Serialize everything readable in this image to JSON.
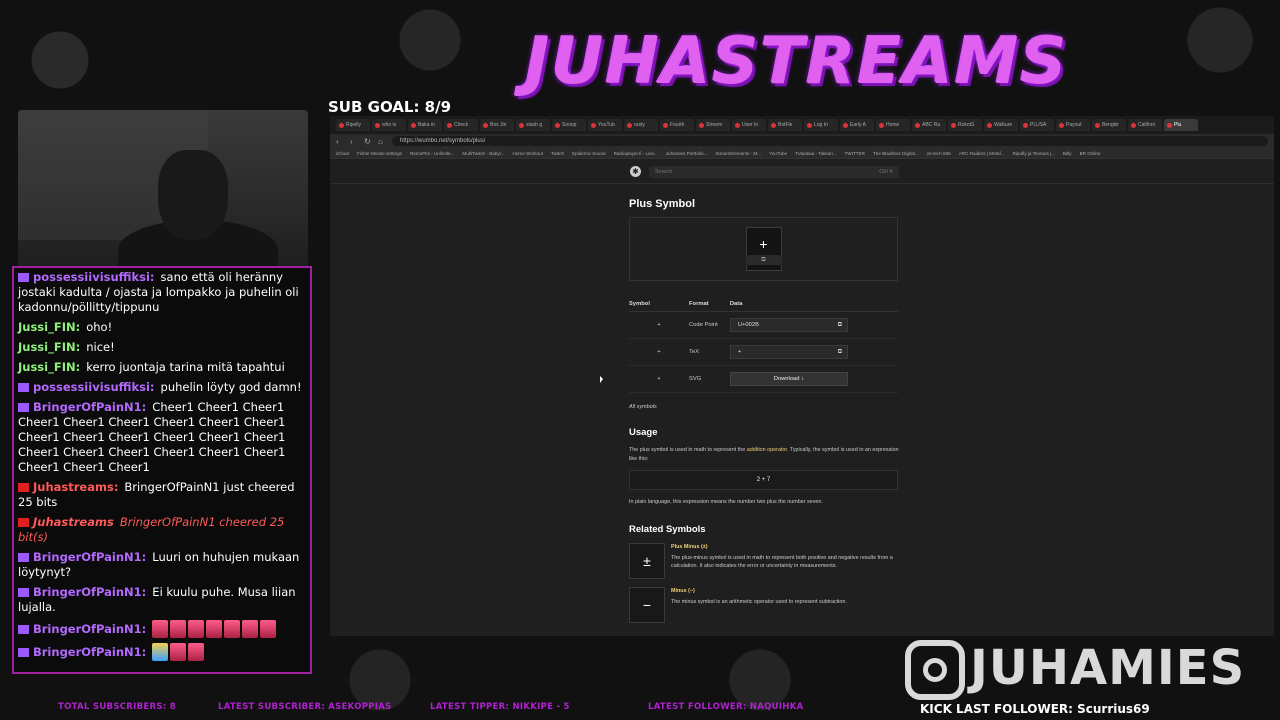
{
  "overlay": {
    "banner": "JUHASTREAMS",
    "sub_goal": "SUB GOAL: 8/9",
    "instagram": "JUHAMIES",
    "kick_follower": "KICK LAST FOLLOWER: Scurrius69",
    "tickers": [
      "TOTAL SUBSCRIBERS: 8",
      "LATEST SUBSCRIBER: ASEKOPPIAS",
      "LATEST TIPPER: NIKKIPE - 5",
      "LATEST FOLLOWER: NAQUIHKA"
    ]
  },
  "chat": {
    "messages": [
      {
        "user": "possessiivisuffiksi:",
        "text": "sano että oli heränny jostaki kadulta / ojasta ja lompakko ja puhelin oli kadonnu/pöllitty/tippunu",
        "color": "#b469ff",
        "badge": "sub"
      },
      {
        "user": "Jussi_FIN:",
        "text": "oho!",
        "color": "#8ef07a",
        "badge": ""
      },
      {
        "user": "Jussi_FIN:",
        "text": "nice!",
        "color": "#8ef07a",
        "badge": ""
      },
      {
        "user": "Jussi_FIN:",
        "text": "kerro juontaja tarina mitä tapahtui",
        "color": "#8ef07a",
        "badge": ""
      },
      {
        "user": "possessiivisuffiksi:",
        "text": "puhelin löyty god damn!",
        "color": "#b469ff",
        "badge": "sub"
      },
      {
        "user": "BringerOfPainN1:",
        "text": "Cheer1 Cheer1 Cheer1 Cheer1 Cheer1 Cheer1 Cheer1 Cheer1 Cheer1 Cheer1 Cheer1 Cheer1 Cheer1 Cheer1 Cheer1 Cheer1 Cheer1 Cheer1 Cheer1 Cheer1 Cheer1 Cheer1 Cheer1 Cheer1",
        "color": "#b469ff",
        "badge": "sub"
      },
      {
        "user": "Juhastreams:",
        "text": "BringerOfPainN1 just cheered 25 bits",
        "color": "#ff5a5a",
        "badge": "cam"
      },
      {
        "user": "Juhastreams",
        "text": "BringerOfPainN1 cheered 25 bit(s)",
        "color": "#ff5a5a",
        "badge": "cam",
        "italic": true
      },
      {
        "user": "BringerOfPainN1:",
        "text": "Luuri on huhujen mukaan löytynyt?",
        "color": "#b469ff",
        "badge": "sub"
      },
      {
        "user": "BringerOfPainN1:",
        "text": "Ei kuulu puhe. Musa liian lujalla.",
        "color": "#b469ff",
        "badge": "sub"
      },
      {
        "user": "BringerOfPainN1:",
        "text": "",
        "color": "#b469ff",
        "badge": "sub",
        "emotes": 7
      },
      {
        "user": "BringerOfPainN1:",
        "text": "",
        "color": "#b469ff",
        "badge": "sub",
        "emotes": 3
      }
    ]
  },
  "browser": {
    "tabs": [
      "Ripelly",
      "who is",
      "Baka m",
      "Check",
      "Box Jin",
      "stash g",
      "Sooop",
      "YouTub",
      "rusty",
      "Fourth",
      "Streem",
      "User In",
      "BotFle",
      "Log In",
      "Early A",
      "Home",
      "ABC Ra",
      "RokotS",
      "Walkure",
      "PLUSA",
      "Payout",
      "Bengkir",
      "Californ",
      "Plu"
    ],
    "url": "https://wumbo.net/symbols/plus/",
    "bookmarks": [
      "iCloud",
      "Fisher Mouse settings",
      "RemoPiIs - Unlimite...",
      "MultiTwitch - Babyl...",
      "Home Workout",
      "Twitch",
      "Epidemic Sound",
      "Radioplayer.fi - Live...",
      "Juhamies Portfolio...",
      "StreamElements - M...",
      "YouTube",
      "TVaiataia - Takkari...",
      "TWITTER",
      "The Blackbox Digital...",
      "ze-tech 865",
      "ARC Raiders | Metaf...",
      "Ripulfy ja Tentaus j...",
      "Bitly",
      "BR Online"
    ],
    "search_placeholder": "Search",
    "search_shortcut": "Ctrl K"
  },
  "page": {
    "title": "Plus Symbol",
    "glyph": "+",
    "copy_icon": "⧉",
    "table_headers": [
      "Symbol",
      "Format",
      "Data"
    ],
    "rows": [
      {
        "symbol": "+",
        "format": "Code Point",
        "data": "U+002B"
      },
      {
        "symbol": "+",
        "format": "TeX",
        "data": "+"
      },
      {
        "symbol": "+",
        "format": "SVG",
        "data": "Download ↓"
      }
    ],
    "all_symbols": "All symbols",
    "usage_title": "Usage",
    "usage_p1_a": "The plus symbol is used in math to represent the ",
    "usage_p1_link": "addition operator",
    "usage_p1_b": ". Typically, the symbol is used in an expression like this:",
    "expression": "2 + 7",
    "usage_p2": "In plain language, this expression means the number two plus the number seven.",
    "related_title": "Related Symbols",
    "related": [
      {
        "glyph": "±",
        "title": "Plus Minus (±)",
        "text": "The plus-minus symbol is used in math to represent both positive and negative results from a calculation. It also indicates the error or uncertainty in measurements."
      },
      {
        "glyph": "−",
        "title": "Minus (−)",
        "text": "The minus symbol is an arithmetic operator used to represent subtraction."
      }
    ]
  }
}
